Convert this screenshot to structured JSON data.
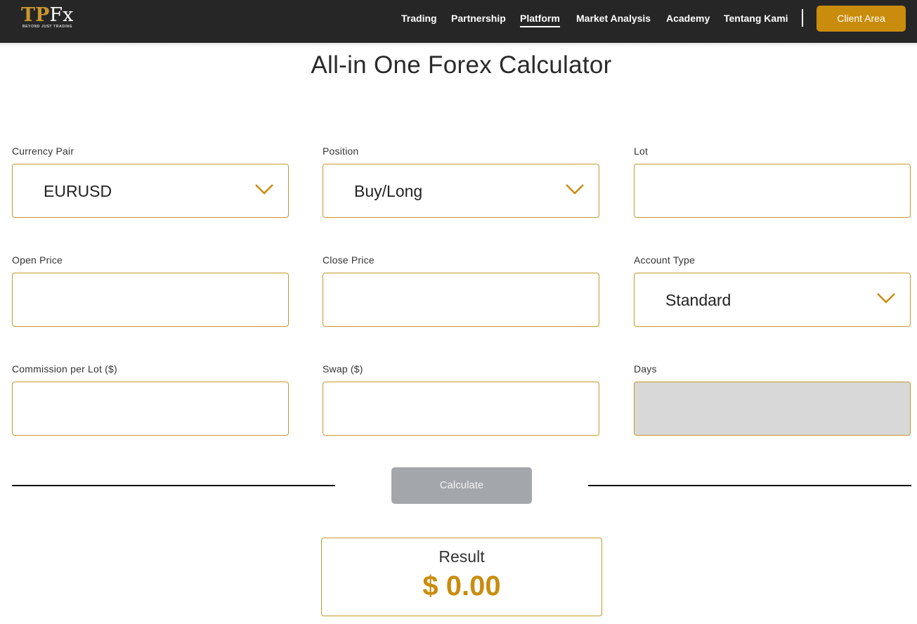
{
  "brand": {
    "logo_text_gold": "TP",
    "logo_text_white": "Fx",
    "tagline": "BEYOND JUST TRADING"
  },
  "nav": {
    "items": [
      {
        "label": "Trading"
      },
      {
        "label": "Partnership"
      },
      {
        "label": "Platform",
        "active": true
      },
      {
        "label": "Market Analysis"
      },
      {
        "label": "Academy"
      },
      {
        "label": "Tentang Kami"
      }
    ],
    "client_area": "Client Area"
  },
  "page": {
    "title": "All-in One Forex Calculator"
  },
  "form": {
    "currency_pair": {
      "label": "Currency Pair",
      "value": "EURUSD"
    },
    "position": {
      "label": "Position",
      "value": "Buy/Long"
    },
    "lot": {
      "label": "Lot",
      "value": ""
    },
    "open_price": {
      "label": "Open Price",
      "value": ""
    },
    "close_price": {
      "label": "Close Price",
      "value": ""
    },
    "account_type": {
      "label": "Account Type",
      "value": "Standard"
    },
    "commission": {
      "label": "Commission per Lot ($)",
      "value": ""
    },
    "swap": {
      "label": "Swap ($)",
      "value": ""
    },
    "days": {
      "label": "Days",
      "value": ""
    },
    "calculate": "Calculate"
  },
  "result": {
    "label": "Result",
    "value": "$ 0.00"
  },
  "colors": {
    "header_bg": "#262626",
    "accent": "#c98c0c",
    "border": "#c6982a",
    "button_disabled": "#a3a6ab"
  }
}
